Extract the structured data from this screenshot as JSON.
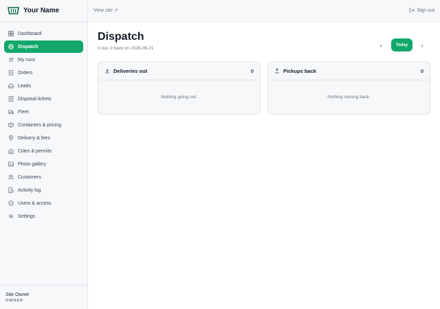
{
  "brand": {
    "name": "Your Name"
  },
  "nav": {
    "items": [
      {
        "label": "Dashboard",
        "icon": "grid-icon"
      },
      {
        "label": "Dispatch",
        "icon": "globe-icon",
        "active": true
      },
      {
        "label": "My runs",
        "icon": "route-icon"
      },
      {
        "label": "Orders",
        "icon": "receipt-icon"
      },
      {
        "label": "Leads",
        "icon": "inbox-icon"
      },
      {
        "label": "Disposal tickets",
        "icon": "ticket-icon"
      },
      {
        "label": "Fleet",
        "icon": "truck-icon"
      },
      {
        "label": "Containers & pricing",
        "icon": "box-icon"
      },
      {
        "label": "Delivery & fees",
        "icon": "pin-icon"
      },
      {
        "label": "Cities & permits",
        "icon": "building-icon"
      },
      {
        "label": "Photo gallery",
        "icon": "image-icon"
      },
      {
        "label": "Customers",
        "icon": "users-icon"
      },
      {
        "label": "Activity log",
        "icon": "history-icon"
      },
      {
        "label": "Users & access",
        "icon": "shield-icon"
      },
      {
        "label": "Settings",
        "icon": "gear-icon"
      }
    ]
  },
  "footer": {
    "user_name": "Site Owner",
    "user_role": "OWNER"
  },
  "topbar": {
    "view_site": "View site ↗",
    "sign_out": "Sign out"
  },
  "page": {
    "title": "Dispatch",
    "subtitle": "0 out, 0 back on 2026-08-21"
  },
  "date_nav": {
    "prev": "‹",
    "today": "Today",
    "next": "›"
  },
  "panels": [
    {
      "title": "Deliveries out",
      "count": "0",
      "empty": "Nothing going out.",
      "icon": "arrow-down-tray-icon"
    },
    {
      "title": "Pickups back",
      "count": "0",
      "empty": "Nothing coming back.",
      "icon": "arrow-up-tray-icon"
    }
  ],
  "colors": {
    "accent": "#12a86b",
    "sidebar_bg": "#f6f8fa",
    "border": "#e3e7eb"
  }
}
